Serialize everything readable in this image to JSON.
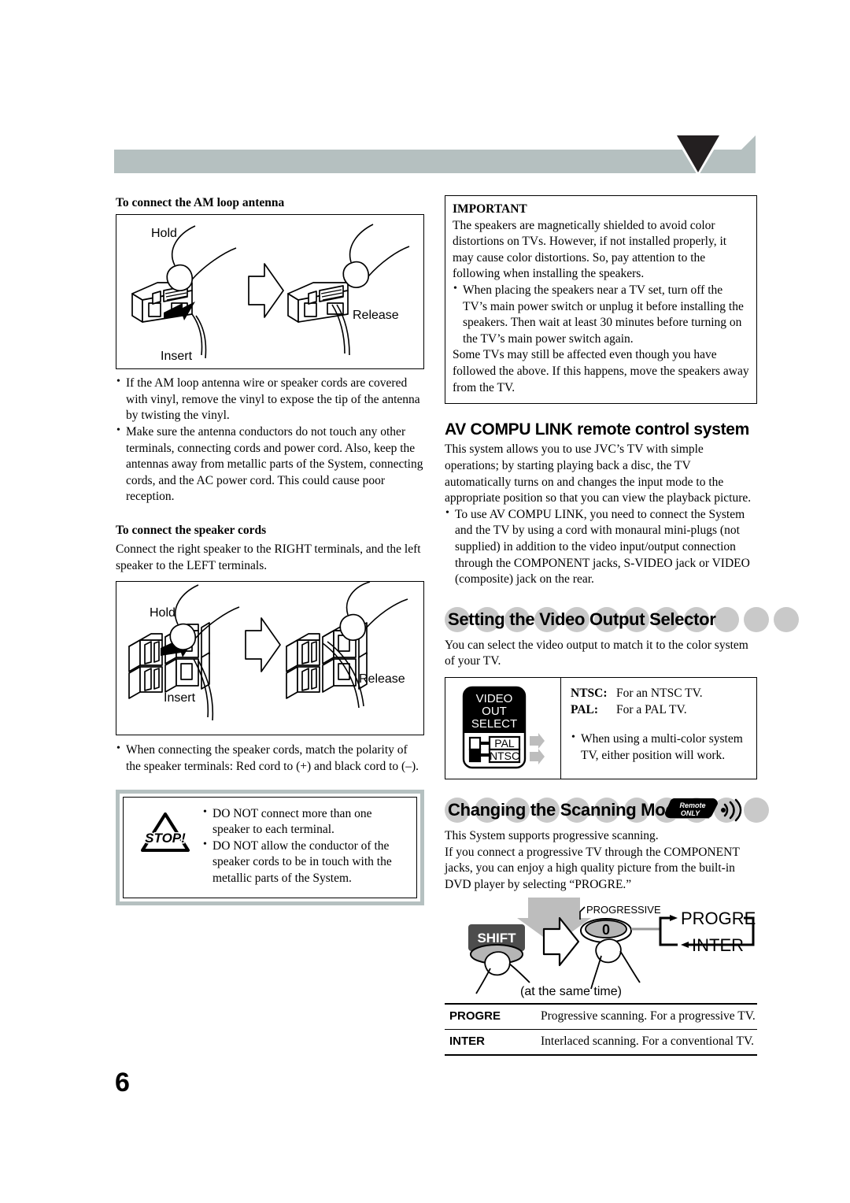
{
  "page": {
    "number": "6"
  },
  "left_column": {
    "antenna_heading": "To connect the AM loop antenna",
    "antenna_figure": {
      "label_hold": "Hold",
      "label_insert": "Insert",
      "label_release": "Release"
    },
    "antenna_bullets": [
      "If the AM loop antenna wire or speaker cords are covered with vinyl, remove the vinyl to expose the tip of the antenna by twisting the vinyl.",
      "Make sure the antenna conductors do not touch any other terminals, connecting cords and power cord. Also, keep the antennas away from metallic parts of the System, connecting cords, and the AC power cord. This could cause poor reception."
    ],
    "speaker_heading": "To connect the speaker cords",
    "speaker_intro": "Connect the right speaker to the RIGHT terminals, and the left speaker to the LEFT terminals.",
    "speaker_figure": {
      "label_hold": "Hold",
      "label_insert": "Insert",
      "label_release": "Release"
    },
    "speaker_bullets": [
      "When connecting the speaker cords, match the polarity of the speaker terminals: Red cord to (+) and black cord to (–)."
    ],
    "warning": {
      "icon_label": "STOP!",
      "items": [
        "DO NOT connect more than one speaker to each terminal.",
        "DO NOT allow the conductor of the speaker cords to be in touch with the metallic parts of the System."
      ]
    }
  },
  "right_column": {
    "important": {
      "title": "IMPORTANT",
      "para1": "The speakers are magnetically shielded to avoid color distortions on TVs. However, if not installed properly, it may cause color distortions. So, pay attention to the following when installing the speakers.",
      "bullet1": "When placing the speakers near a TV set, turn off the TV’s main power switch or unplug it before installing the speakers. Then wait at least 30 minutes before turning on the TV’s main power switch again.",
      "para2": "Some TVs may still be affected even though you have followed the above. If this happens, move the speakers away from the TV."
    },
    "avcompu": {
      "heading": "AV COMPU LINK remote control system",
      "para": "This system allows you to use JVC’s TV with simple operations; by starting playing back a disc, the TV automatically turns on and changes the input mode to the appropriate position so that you can view the playback picture.",
      "bullet": "To use AV COMPU LINK, you need to connect the System and the TV by using a cord with monaural mini-plugs (not supplied) in addition to the video input/output connection through the COMPONENT jacks, S-VIDEO jack or VIDEO (composite) jack on the rear."
    },
    "video_output": {
      "heading": "Setting the Video Output Selector",
      "intro": "You can select the video output to match it to the color system of your TV.",
      "switch_graphic": {
        "line1": "VIDEO",
        "line2": "OUT",
        "line3": "SELECT",
        "pos_top": "PAL",
        "pos_bottom": "NTSC"
      },
      "rows": [
        {
          "key": "NTSC:",
          "value": "For an NTSC TV."
        },
        {
          "key": "PAL:",
          "value": "For a PAL TV."
        }
      ],
      "note": "When using a multi-color system TV, either position will work."
    },
    "scanning": {
      "heading": "Changing the Scanning Mode",
      "badge_line1": "Remote",
      "badge_line2": "ONLY",
      "para": "This System supports progressive scanning.\nIf you connect a progressive TV through the COMPONENT jacks, you can enjoy a high quality picture from the built-in DVD player by selecting “PROGRE.”",
      "diagram": {
        "shift_label": "SHIFT",
        "progressive_label": "PROGRESSIVE",
        "button_label": "0",
        "same_time": "(at the same time)",
        "cycle_top": "PROGRE",
        "cycle_bottom": "INTER"
      },
      "table": [
        {
          "mode": "PROGRE",
          "desc": "Progressive scanning. For a progressive TV."
        },
        {
          "mode": "INTER",
          "desc": "Interlaced scanning. For a conventional TV."
        }
      ]
    }
  },
  "colors": {
    "banner_gray": "#b5c0c0",
    "banner_black": "#231f20",
    "circle_gray": "#c9c9c9",
    "arrow_gray": "#bdbdbd"
  }
}
